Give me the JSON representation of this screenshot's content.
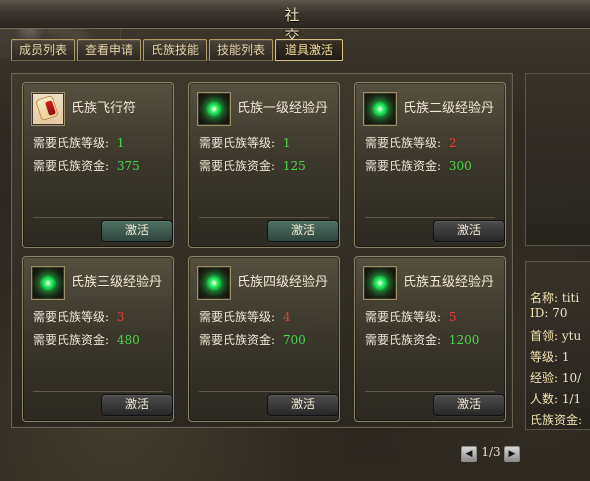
{
  "window": {
    "title": "社 交"
  },
  "tabs": [
    {
      "label": "成员列表"
    },
    {
      "label": "查看申请"
    },
    {
      "label": "氏族技能"
    },
    {
      "label": "技能列表"
    },
    {
      "label": "道具激活"
    }
  ],
  "cards": [
    {
      "name": "氏族飞行符",
      "icon": "scroll-icon",
      "level_label": "需要氏族等级:",
      "level_value": "1",
      "level_color": "#49d84a",
      "fund_label": "需要氏族资金:",
      "fund_value": "375",
      "fund_color": "#49d84a",
      "button": "激活",
      "button_state": "active"
    },
    {
      "name": "氏族一级经验丹",
      "icon": "green-orb-icon",
      "level_label": "需要氏族等级:",
      "level_value": "1",
      "level_color": "#49d84a",
      "fund_label": "需要氏族资金:",
      "fund_value": "125",
      "fund_color": "#49d84a",
      "button": "激活",
      "button_state": "active"
    },
    {
      "name": "氏族二级经验丹",
      "icon": "green-orb-icon",
      "level_label": "需要氏族等级:",
      "level_value": "2",
      "level_color": "#f03a3a",
      "fund_label": "需要氏族资金:",
      "fund_value": "300",
      "fund_color": "#49d84a",
      "button": "激活",
      "button_state": "inactive"
    },
    {
      "name": "氏族三级经验丹",
      "icon": "green-orb-icon",
      "level_label": "需要氏族等级:",
      "level_value": "3",
      "level_color": "#f03a3a",
      "fund_label": "需要氏族资金:",
      "fund_value": "480",
      "fund_color": "#49d84a",
      "button": "激活",
      "button_state": "inactive"
    },
    {
      "name": "氏族四级经验丹",
      "icon": "green-orb-icon",
      "level_label": "需要氏族等级:",
      "level_value": "4",
      "level_color": "#f03a3a",
      "fund_label": "需要氏族资金:",
      "fund_value": "700",
      "fund_color": "#49d84a",
      "button": "激活",
      "button_state": "inactive"
    },
    {
      "name": "氏族五级经验丹",
      "icon": "green-orb-icon",
      "level_label": "需要氏族等级:",
      "level_value": "5",
      "level_color": "#f03a3a",
      "fund_label": "需要氏族资金:",
      "fund_value": "1200",
      "fund_color": "#49d84a",
      "button": "激活",
      "button_state": "inactive"
    }
  ],
  "info": {
    "rows": [
      {
        "label": "名称:",
        "value": "titi"
      },
      {
        "label": "ID:",
        "value": "70"
      },
      {
        "label": "首领:",
        "value": "ytu"
      },
      {
        "label": "等级:",
        "value": "1"
      },
      {
        "label": "经验:",
        "value": "10/"
      },
      {
        "label": "人数:",
        "value": "1/1"
      },
      {
        "label": "氏族资金:",
        "value": ""
      }
    ]
  },
  "pager": {
    "prev": "◀",
    "text": "1/3",
    "next": "▶"
  }
}
